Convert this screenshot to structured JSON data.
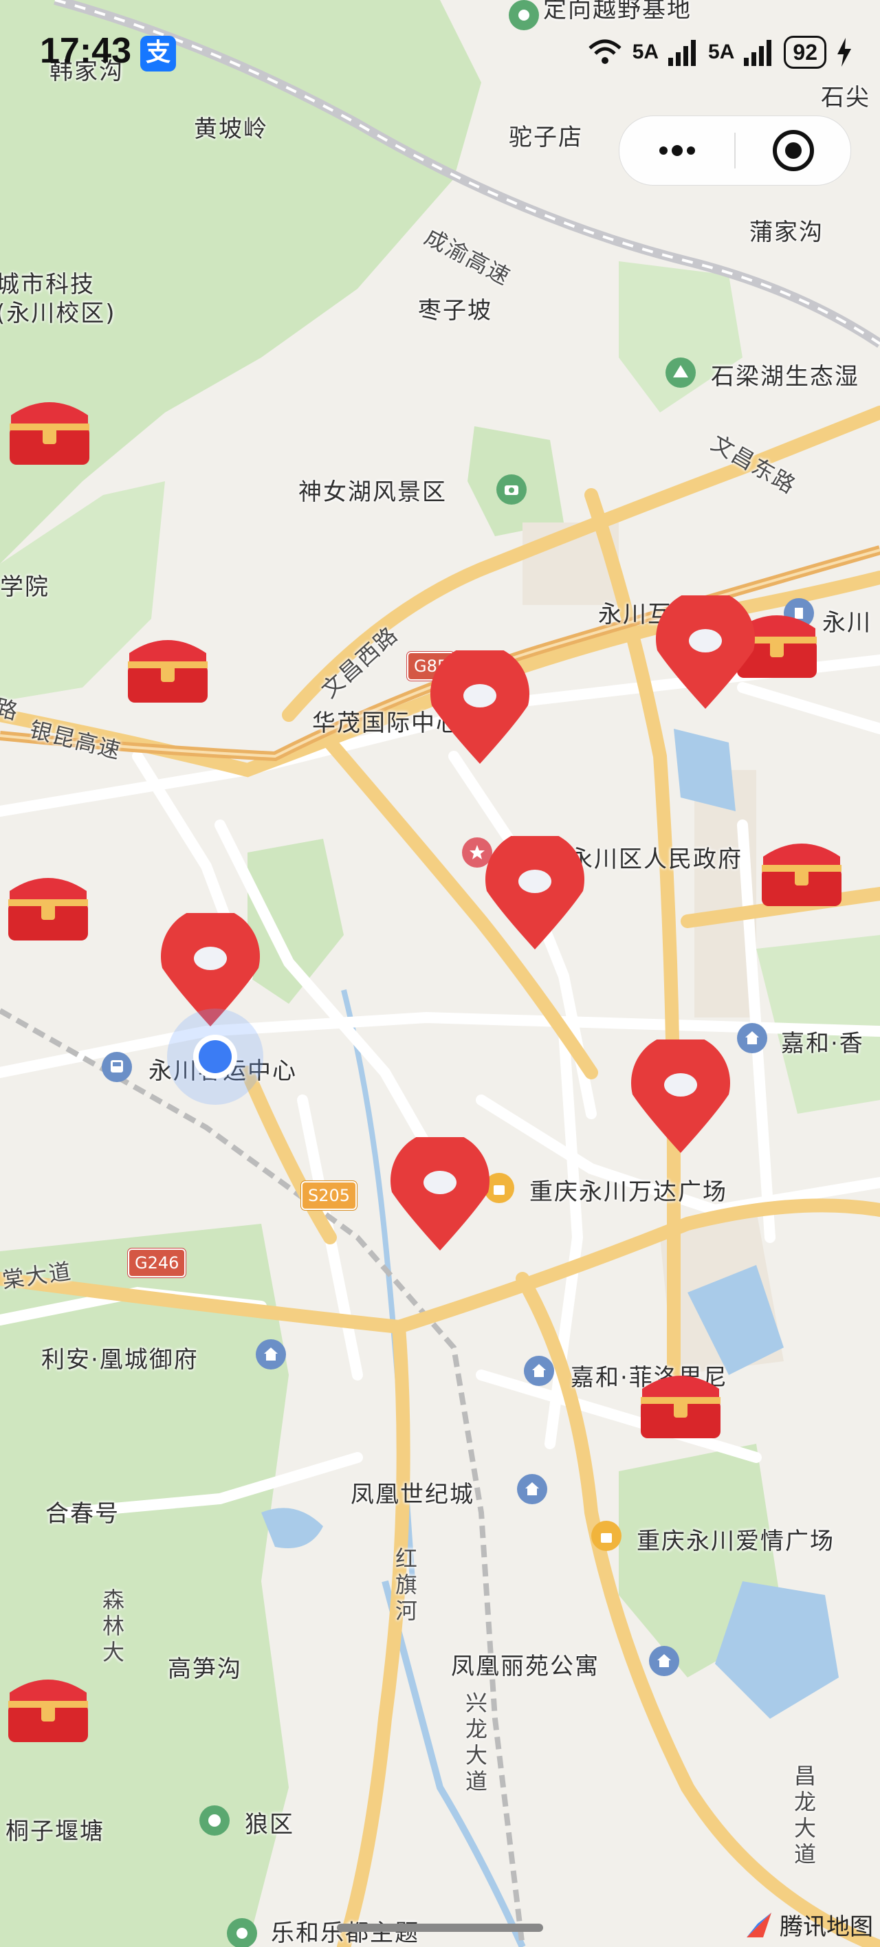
{
  "status_bar": {
    "time": "17:43",
    "app_badge": "支",
    "signal1": "5A",
    "signal2": "5A",
    "battery": "92"
  },
  "capsule": {
    "more_icon": "more-dots-icon",
    "close_icon": "target-close-icon"
  },
  "map_labels": {
    "top_poi": "定向越野基地",
    "hanjiagou": "韩家沟",
    "shijian": "石尖",
    "huangpoling": "黄坡岭",
    "tuozidian": "驼子店",
    "chengyu": "成渝高速",
    "pujiagou": "蒲家沟",
    "college": "城市科技",
    "college2": "(永川校区)",
    "zaozipo": "枣子坡",
    "shilianghu": "石梁湖生态湿",
    "wenchangdong": "文昌东路",
    "shennuhu": "神女湖风景区",
    "xueyuan": "学院",
    "wenchangxi": "文昌西路",
    "yongchuanhutong": "永川互通",
    "yongchuan_right": "永川",
    "yinkun": "银昆高速",
    "lu": "路",
    "huamao": "华茂国际中心",
    "renmin": "重庆市永川区人民政府",
    "keyun": "永川客运中心",
    "jiahe": "嘉和·香",
    "wanda": "重庆永川万达广场",
    "tangdadao": "棠大道",
    "lian": "利安·凰城御府",
    "jiahe2": "嘉和·菲洛里尼",
    "fenghuang": "凤凰世纪城",
    "aiqing": "重庆永川爱情广场",
    "hechunhao": "合春号",
    "hongqihe": "红旗河",
    "senlin": "森林大",
    "gaosungou": "高笋沟",
    "fenghuangliyuan": "凤凰丽苑公寓",
    "xinglong": "兴龙大道",
    "changlong": "昌龙大道",
    "tongziyantang": "桐子堰塘",
    "langqu": "狼区",
    "lehe": "乐和乐都主题"
  },
  "shields": {
    "g85": "G85",
    "s205": "S205",
    "g246": "G246"
  },
  "markers": {
    "pin_icon": "map-pin-icon",
    "chest_icon": "treasure-chest-icon",
    "location_icon": "current-location-icon"
  },
  "watermark": "腾讯地图",
  "colors": {
    "pin": "#e63b3b",
    "chest": "#d9262a",
    "road_major": "#f5d58a",
    "road_minor": "#ffffff",
    "green": "#c8e4b7",
    "water": "#a7cbe8",
    "location": "#3b7cf4"
  }
}
